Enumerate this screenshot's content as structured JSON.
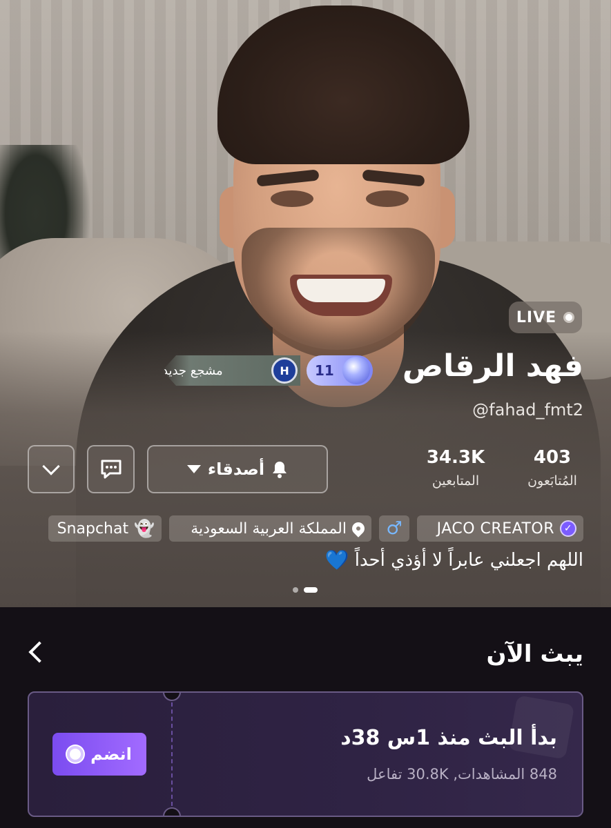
{
  "profile": {
    "live_label": "LIVE",
    "name": "فهد الرقاص",
    "level": "11",
    "fan_badge": "مشجع جديد",
    "fan_crest": "H",
    "handle": "@fahad_fmt2",
    "friends_label": "أصدقاء",
    "stats": {
      "following_count": "403",
      "following_label": "المُتابَعون",
      "followers_count": "34.3K",
      "followers_label": "المتابعين"
    },
    "tags": {
      "creator": "JACO CREATOR",
      "gender_symbol": "♂",
      "country": "المملكة العربية السعودية",
      "snapchat": "Snapchat"
    },
    "bio": "اللهم اجعلني عابراً لا أؤذي أحداً",
    "bio_emoji": "💙"
  },
  "live_now": {
    "title": "يبث الآن",
    "started": "بدأ البث منذ 1س 38د",
    "meta": "848 المشاهدات, 30.8K تفاعل",
    "join_label": "انضم"
  },
  "icons": {
    "bell": "bell-icon",
    "message": "message-icon",
    "chevron": "chevron-down-icon",
    "back": "chevron-left-icon",
    "pin": "location-pin-icon",
    "snap": "snapchat-ghost-icon"
  },
  "colors": {
    "accent": "#8b5cf6",
    "background": "#141016",
    "ticket": "#2f2344"
  }
}
